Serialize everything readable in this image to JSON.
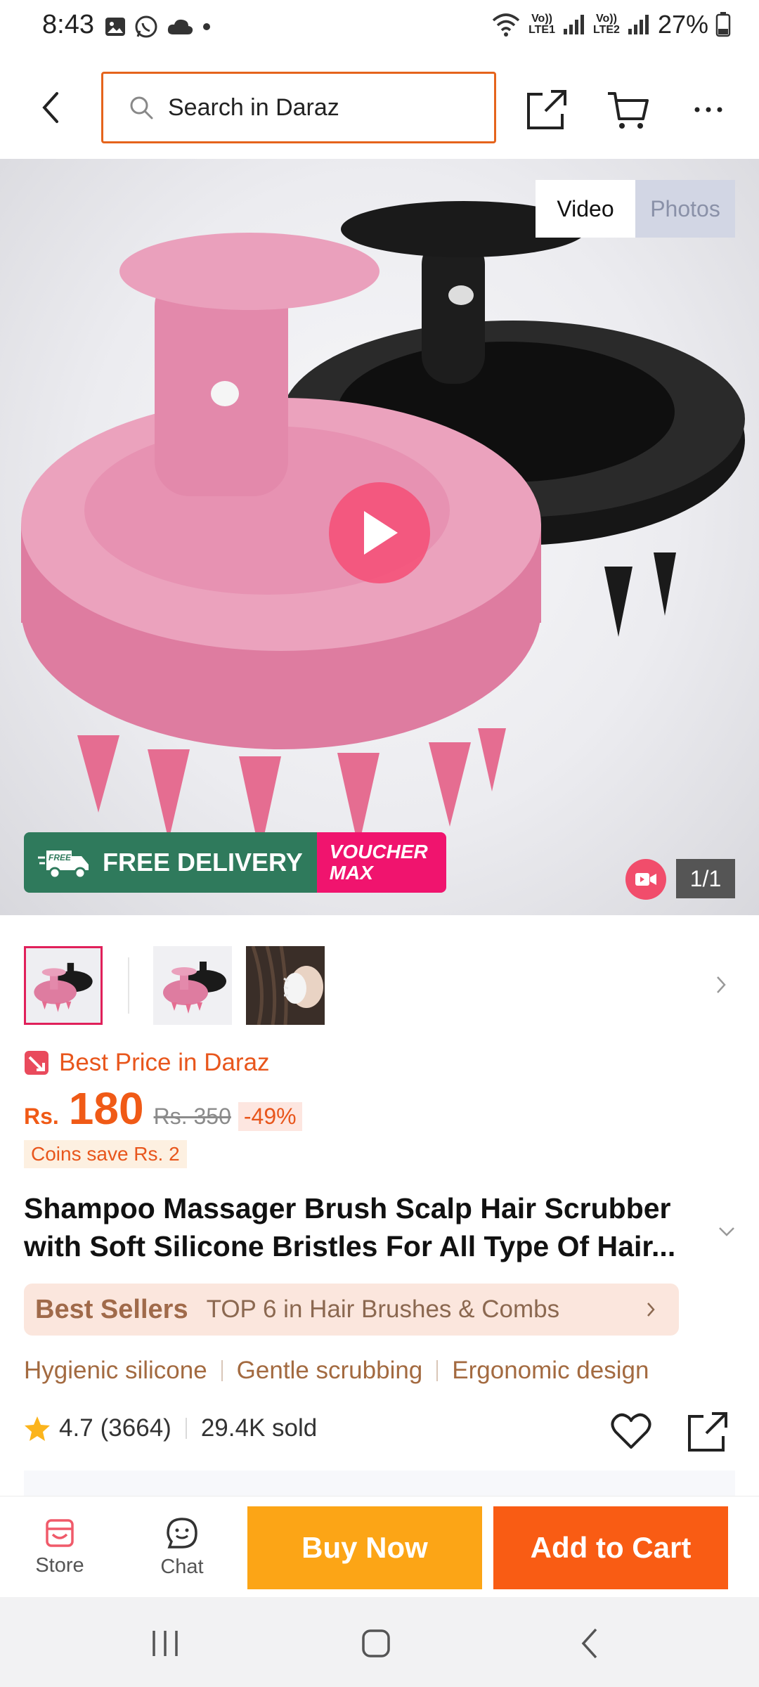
{
  "status_bar": {
    "time": "8:43",
    "battery": "27%",
    "sim1": [
      "Vo))",
      "LTE1"
    ],
    "sim2": [
      "Vo))",
      "LTE2"
    ]
  },
  "top_nav": {
    "search_placeholder": "Search in Daraz",
    "accent_color": "#e5641c"
  },
  "media": {
    "tabs": [
      {
        "label": "Video",
        "active": true
      },
      {
        "label": "Photos",
        "active": false
      }
    ],
    "promo_free": "FREE DELIVERY",
    "promo_free_badge": "FREE",
    "promo_voucher_line1": "VOUCHER",
    "promo_voucher_line2": "MAX",
    "counter": "1/1"
  },
  "price": {
    "badge": "Best Price in Daraz",
    "currency": "Rs.",
    "current": "180",
    "original": "Rs. 350",
    "discount": "-49%",
    "coins": "Coins save Rs. 2"
  },
  "product": {
    "title": "Shampoo Massager Brush Scalp Hair Scrubber with Soft Silicone Bristles For All Type Of Hair..."
  },
  "best_sellers": {
    "title": "Best Sellers",
    "text": "TOP 6 in Hair Brushes & Combs"
  },
  "features": [
    "Hygienic silicone",
    "Gentle scrubbing",
    "Ergonomic design"
  ],
  "rating": {
    "score": "4.7",
    "count": "(3664)",
    "sold": "29.4K sold"
  },
  "action_bar": {
    "store": "Store",
    "chat": "Chat",
    "buy_now": "Buy Now",
    "add_to_cart": "Add to Cart"
  },
  "colors": {
    "orange": "#f95c14",
    "yellow": "#fca516",
    "pink": "#e0205a",
    "green": "#2f7a5c"
  }
}
